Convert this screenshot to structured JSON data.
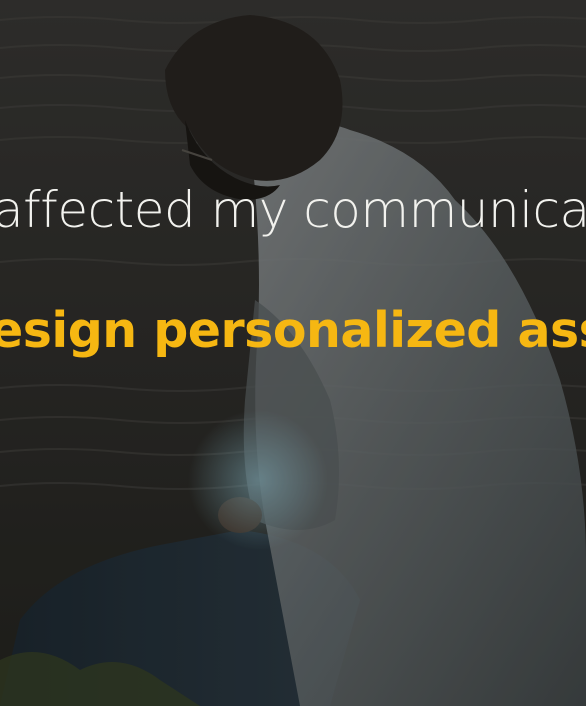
{
  "captions": {
    "line_1": "affected my communicat",
    "line_2": "esign personalized ass"
  },
  "colors": {
    "caption_primary": "#f2f2ee",
    "caption_highlight": "#f6b712"
  }
}
